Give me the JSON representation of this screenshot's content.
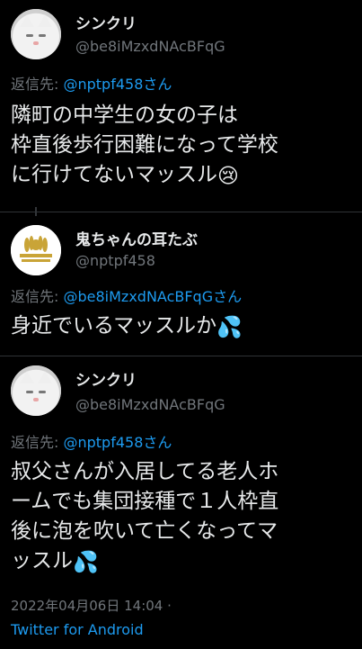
{
  "tweets": [
    {
      "name": "シンクリ",
      "handle": "@be8iMzxdNAcBFqG",
      "reply_label": "返信先: ",
      "reply_to": "@nptpf458さん",
      "text_lines": [
        "隣町の中学生の女の子は",
        "枠直後歩行困難になって学校",
        "に行けてないマッスル"
      ],
      "emoji": "😢"
    },
    {
      "name": "鬼ちゃんの耳たぶ",
      "handle": "@nptpf458",
      "reply_label": "返信先: ",
      "reply_to": "@be8iMzxdNAcBFqGさん",
      "text_lines": [
        "身近でいるマッスルか"
      ],
      "emoji": "💦"
    },
    {
      "name": "シンクリ",
      "handle": "@be8iMzxdNAcBFqG",
      "reply_label": "返信先: ",
      "reply_to": "@nptpf458さん",
      "text_lines": [
        "叔父さんが入居してる老人ホ",
        "ームでも集団接種で１人枠直",
        "後に泡を吹いて亡くなってマ",
        "ッスル"
      ],
      "emoji": "💦",
      "timestamp": "2022年04月06日 14:04 ·",
      "source": "Twitter for Android"
    }
  ],
  "colors": {
    "bg": "#000000",
    "text": "#e7e9ea",
    "muted": "#71767b",
    "link": "#1d9bf0"
  },
  "icons": [
    "cat-avatar",
    "crest-logo-avatar",
    "crying-face-emoji",
    "sweat-droplets-emoji"
  ]
}
